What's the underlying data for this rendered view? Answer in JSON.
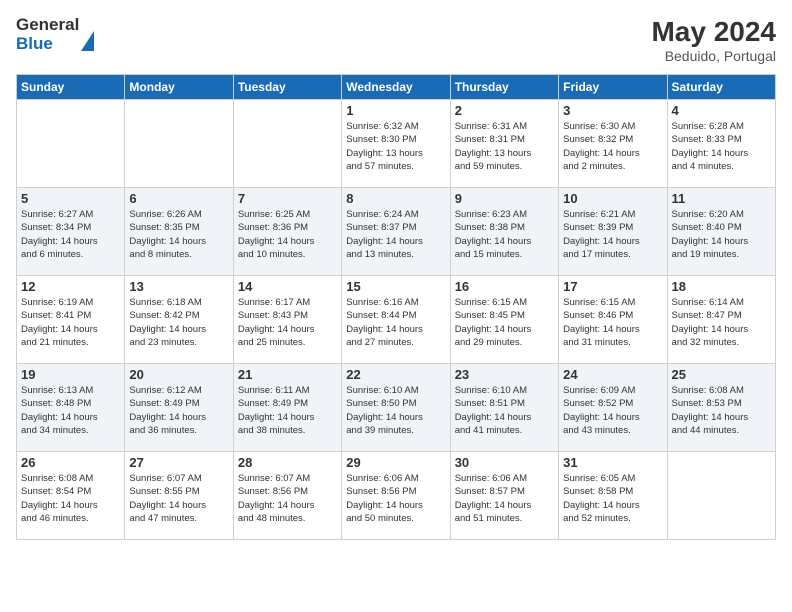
{
  "logo": {
    "text_general": "General",
    "text_blue": "Blue"
  },
  "header": {
    "month_year": "May 2024",
    "location": "Beduido, Portugal"
  },
  "weekdays": [
    "Sunday",
    "Monday",
    "Tuesday",
    "Wednesday",
    "Thursday",
    "Friday",
    "Saturday"
  ],
  "rows": [
    {
      "alt": false,
      "cells": [
        {
          "day": "",
          "info": ""
        },
        {
          "day": "",
          "info": ""
        },
        {
          "day": "",
          "info": ""
        },
        {
          "day": "1",
          "info": "Sunrise: 6:32 AM\nSunset: 8:30 PM\nDaylight: 13 hours\nand 57 minutes."
        },
        {
          "day": "2",
          "info": "Sunrise: 6:31 AM\nSunset: 8:31 PM\nDaylight: 13 hours\nand 59 minutes."
        },
        {
          "day": "3",
          "info": "Sunrise: 6:30 AM\nSunset: 8:32 PM\nDaylight: 14 hours\nand 2 minutes."
        },
        {
          "day": "4",
          "info": "Sunrise: 6:28 AM\nSunset: 8:33 PM\nDaylight: 14 hours\nand 4 minutes."
        }
      ]
    },
    {
      "alt": true,
      "cells": [
        {
          "day": "5",
          "info": "Sunrise: 6:27 AM\nSunset: 8:34 PM\nDaylight: 14 hours\nand 6 minutes."
        },
        {
          "day": "6",
          "info": "Sunrise: 6:26 AM\nSunset: 8:35 PM\nDaylight: 14 hours\nand 8 minutes."
        },
        {
          "day": "7",
          "info": "Sunrise: 6:25 AM\nSunset: 8:36 PM\nDaylight: 14 hours\nand 10 minutes."
        },
        {
          "day": "8",
          "info": "Sunrise: 6:24 AM\nSunset: 8:37 PM\nDaylight: 14 hours\nand 13 minutes."
        },
        {
          "day": "9",
          "info": "Sunrise: 6:23 AM\nSunset: 8:38 PM\nDaylight: 14 hours\nand 15 minutes."
        },
        {
          "day": "10",
          "info": "Sunrise: 6:21 AM\nSunset: 8:39 PM\nDaylight: 14 hours\nand 17 minutes."
        },
        {
          "day": "11",
          "info": "Sunrise: 6:20 AM\nSunset: 8:40 PM\nDaylight: 14 hours\nand 19 minutes."
        }
      ]
    },
    {
      "alt": false,
      "cells": [
        {
          "day": "12",
          "info": "Sunrise: 6:19 AM\nSunset: 8:41 PM\nDaylight: 14 hours\nand 21 minutes."
        },
        {
          "day": "13",
          "info": "Sunrise: 6:18 AM\nSunset: 8:42 PM\nDaylight: 14 hours\nand 23 minutes."
        },
        {
          "day": "14",
          "info": "Sunrise: 6:17 AM\nSunset: 8:43 PM\nDaylight: 14 hours\nand 25 minutes."
        },
        {
          "day": "15",
          "info": "Sunrise: 6:16 AM\nSunset: 8:44 PM\nDaylight: 14 hours\nand 27 minutes."
        },
        {
          "day": "16",
          "info": "Sunrise: 6:15 AM\nSunset: 8:45 PM\nDaylight: 14 hours\nand 29 minutes."
        },
        {
          "day": "17",
          "info": "Sunrise: 6:15 AM\nSunset: 8:46 PM\nDaylight: 14 hours\nand 31 minutes."
        },
        {
          "day": "18",
          "info": "Sunrise: 6:14 AM\nSunset: 8:47 PM\nDaylight: 14 hours\nand 32 minutes."
        }
      ]
    },
    {
      "alt": true,
      "cells": [
        {
          "day": "19",
          "info": "Sunrise: 6:13 AM\nSunset: 8:48 PM\nDaylight: 14 hours\nand 34 minutes."
        },
        {
          "day": "20",
          "info": "Sunrise: 6:12 AM\nSunset: 8:49 PM\nDaylight: 14 hours\nand 36 minutes."
        },
        {
          "day": "21",
          "info": "Sunrise: 6:11 AM\nSunset: 8:49 PM\nDaylight: 14 hours\nand 38 minutes."
        },
        {
          "day": "22",
          "info": "Sunrise: 6:10 AM\nSunset: 8:50 PM\nDaylight: 14 hours\nand 39 minutes."
        },
        {
          "day": "23",
          "info": "Sunrise: 6:10 AM\nSunset: 8:51 PM\nDaylight: 14 hours\nand 41 minutes."
        },
        {
          "day": "24",
          "info": "Sunrise: 6:09 AM\nSunset: 8:52 PM\nDaylight: 14 hours\nand 43 minutes."
        },
        {
          "day": "25",
          "info": "Sunrise: 6:08 AM\nSunset: 8:53 PM\nDaylight: 14 hours\nand 44 minutes."
        }
      ]
    },
    {
      "alt": false,
      "cells": [
        {
          "day": "26",
          "info": "Sunrise: 6:08 AM\nSunset: 8:54 PM\nDaylight: 14 hours\nand 46 minutes."
        },
        {
          "day": "27",
          "info": "Sunrise: 6:07 AM\nSunset: 8:55 PM\nDaylight: 14 hours\nand 47 minutes."
        },
        {
          "day": "28",
          "info": "Sunrise: 6:07 AM\nSunset: 8:56 PM\nDaylight: 14 hours\nand 48 minutes."
        },
        {
          "day": "29",
          "info": "Sunrise: 6:06 AM\nSunset: 8:56 PM\nDaylight: 14 hours\nand 50 minutes."
        },
        {
          "day": "30",
          "info": "Sunrise: 6:06 AM\nSunset: 8:57 PM\nDaylight: 14 hours\nand 51 minutes."
        },
        {
          "day": "31",
          "info": "Sunrise: 6:05 AM\nSunset: 8:58 PM\nDaylight: 14 hours\nand 52 minutes."
        },
        {
          "day": "",
          "info": ""
        }
      ]
    }
  ]
}
